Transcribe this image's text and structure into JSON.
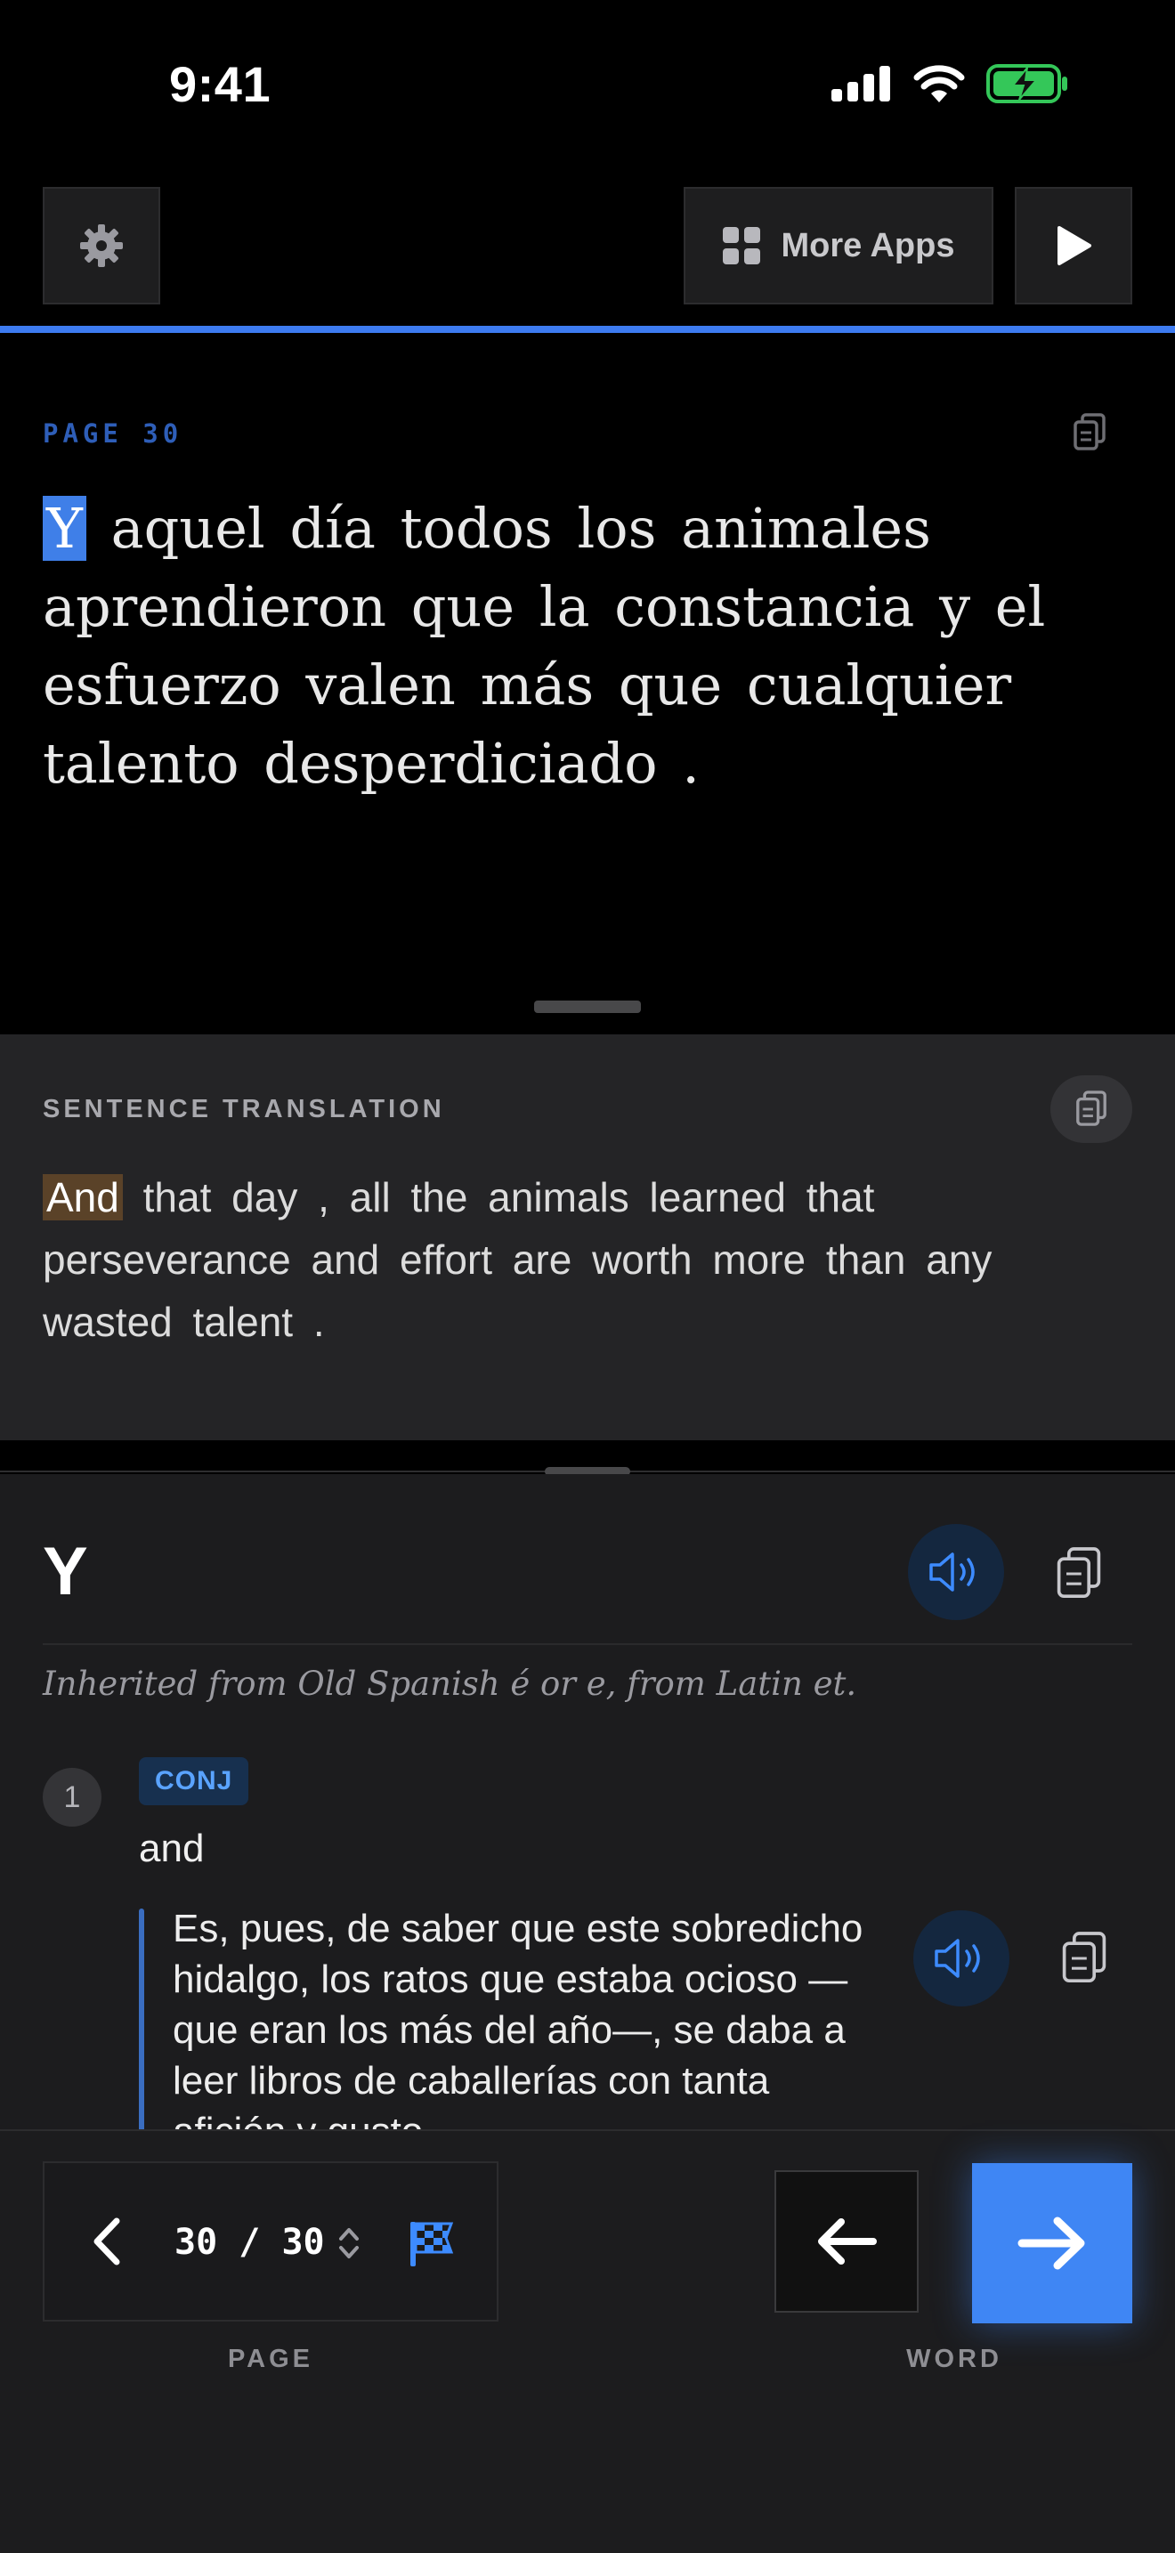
{
  "status_bar": {
    "time": "9:41"
  },
  "toolbar": {
    "more_apps_label": "More Apps"
  },
  "reading": {
    "page_label": "PAGE 30",
    "highlighted_word": "Y",
    "text_rest": "aquel día todos los animales aprendieron que la constancia y el esfuerzo valen más que cualquier talento desperdiciado ."
  },
  "translation": {
    "label": "SENTENCE TRANSLATION",
    "highlighted_word": "And",
    "text_rest": "that day , all the animals learned that perseverance and effort are worth more than any wasted talent ."
  },
  "dictionary": {
    "word": "Y",
    "etymology": "Inherited from Old Spanish é or e, from Latin et.",
    "senses": [
      {
        "number": "1",
        "pos": "CONJ",
        "gloss": "and",
        "example": "Es, pues, de saber que este sobredicho hidalgo, los ratos que estaba ocioso —que eran los más del año—, se daba a leer libros de caballerías con tanta afición y gusto"
      }
    ]
  },
  "navigation": {
    "page_current": "30",
    "page_separator": "/",
    "page_total": "30",
    "page_caption": "PAGE",
    "word_caption": "WORD"
  },
  "colors": {
    "accent": "#3f86f4",
    "highlight_spanish": "#3f7fe8",
    "highlight_translation": "#5a4228",
    "battery_green": "#34c759"
  },
  "icons": {
    "settings": "gear-icon",
    "more_apps": "grid-icon",
    "play": "play-icon",
    "copy": "copy-icon",
    "speaker": "speaker-icon",
    "prev_page": "chevron-left-icon",
    "stepper": "chevron-up-down-icon",
    "finish": "checkered-flag-icon",
    "prev_word": "arrow-left-icon",
    "next_word": "arrow-right-icon"
  },
  "reading_progress": 1.0
}
